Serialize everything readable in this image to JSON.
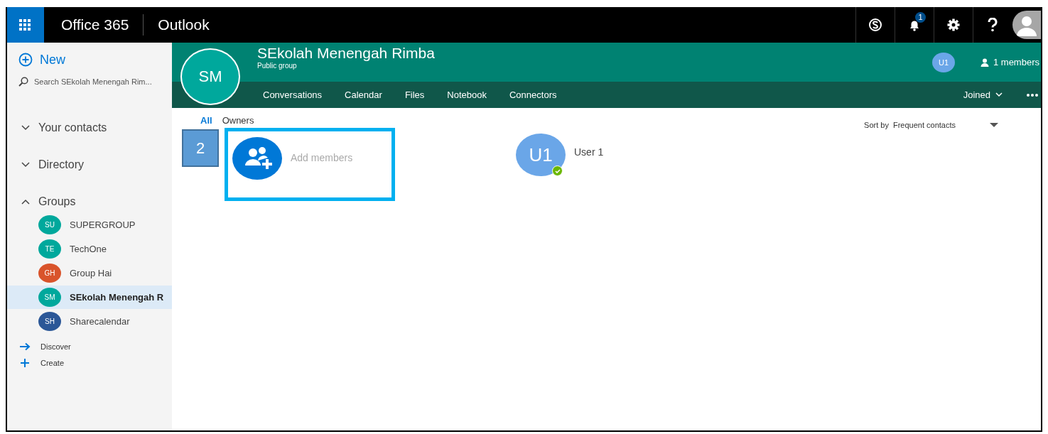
{
  "top_bar": {
    "app_title": "Office 365",
    "app_name": "Outlook",
    "notification_count": "1"
  },
  "sidebar": {
    "new_button": "New",
    "search": {
      "placeholder": "Search SEkolah Menengah Rim..."
    },
    "sections": [
      {
        "label": "Your contacts",
        "expanded": false
      },
      {
        "label": "Directory",
        "expanded": false
      },
      {
        "label": "Groups",
        "expanded": true,
        "items": [
          {
            "initials": "SU",
            "name": "SUPERGROUP",
            "color": "#00a89c",
            "selected": false
          },
          {
            "initials": "TE",
            "name": "TechOne",
            "color": "#00a89c",
            "selected": false
          },
          {
            "initials": "GH",
            "name": "Group Hai",
            "color": "#d9542b",
            "selected": false
          },
          {
            "initials": "SM",
            "name": "SEkolah Menengah R",
            "color": "#00a89c",
            "selected": true
          },
          {
            "initials": "SH",
            "name": "Sharecalendar",
            "color": "#2b5797",
            "selected": false
          }
        ]
      }
    ],
    "actions": [
      {
        "kind": "discover",
        "label": "Discover"
      },
      {
        "kind": "create",
        "label": "Create"
      }
    ]
  },
  "group": {
    "initials": "SM",
    "name": "SEkolah Menengah Rimba",
    "subtitle": "Public group",
    "member_avatar": "U1",
    "members_count": "1 members",
    "tabs": [
      "Conversations",
      "Calendar",
      "Files",
      "Notebook",
      "Connectors"
    ],
    "joined": "Joined"
  },
  "filters": [
    {
      "label": "All",
      "selected": true
    },
    {
      "label": "Owners",
      "selected": false
    }
  ],
  "sort": {
    "label": "Sort by",
    "value": "Frequent contacts"
  },
  "add_members": "Add members",
  "members": [
    {
      "initials": "U1",
      "name": "User 1",
      "online": true
    }
  ],
  "callout": "2"
}
